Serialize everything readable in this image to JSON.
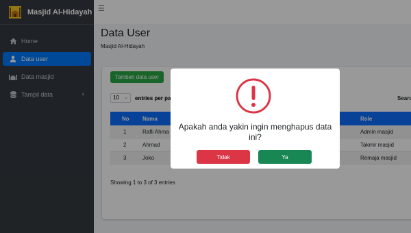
{
  "sidebar": {
    "brand": "Masjid Al-Hidayah",
    "items": [
      {
        "label": "Home",
        "icon": "home-icon"
      },
      {
        "label": "Data user",
        "icon": "user-icon",
        "active": true
      },
      {
        "label": "Data masjid",
        "icon": "mosque-icon"
      },
      {
        "label": "Tampil data",
        "icon": "database-icon",
        "has_submenu": true
      }
    ]
  },
  "topbar": {
    "menu_icon": "hamburger-icon"
  },
  "page": {
    "title": "Data User",
    "subtitle": "Masjid Al-Hidayah"
  },
  "card": {
    "add_button": "Tambah data user",
    "length_value": "10",
    "length_label": "entries per pa",
    "search_label": "Searc",
    "columns": {
      "no": "No",
      "nama": "Nama",
      "role": "Role"
    },
    "rows": [
      {
        "no": "1",
        "nama": "Rafli Ahma",
        "role": "Admin masjid"
      },
      {
        "no": "2",
        "nama": "Ahmad",
        "role": "Takmir masjid"
      },
      {
        "no": "3",
        "nama": "Joko",
        "role": "Remaja masjid"
      }
    ],
    "info": "Showing 1 to 3 of 3 entries"
  },
  "modal": {
    "icon": "warning-icon",
    "message": "Apakah anda yakin ingin menghapus data ini?",
    "cancel_label": "Tidak",
    "confirm_label": "Ya"
  },
  "colors": {
    "sidebar_bg": "#343a40",
    "active_nav": "#007bff",
    "add_button": "#28a745",
    "table_header": "#0d6efd",
    "cancel_button": "#dc3545",
    "confirm_button": "#198754",
    "warning": "#dc3545"
  }
}
